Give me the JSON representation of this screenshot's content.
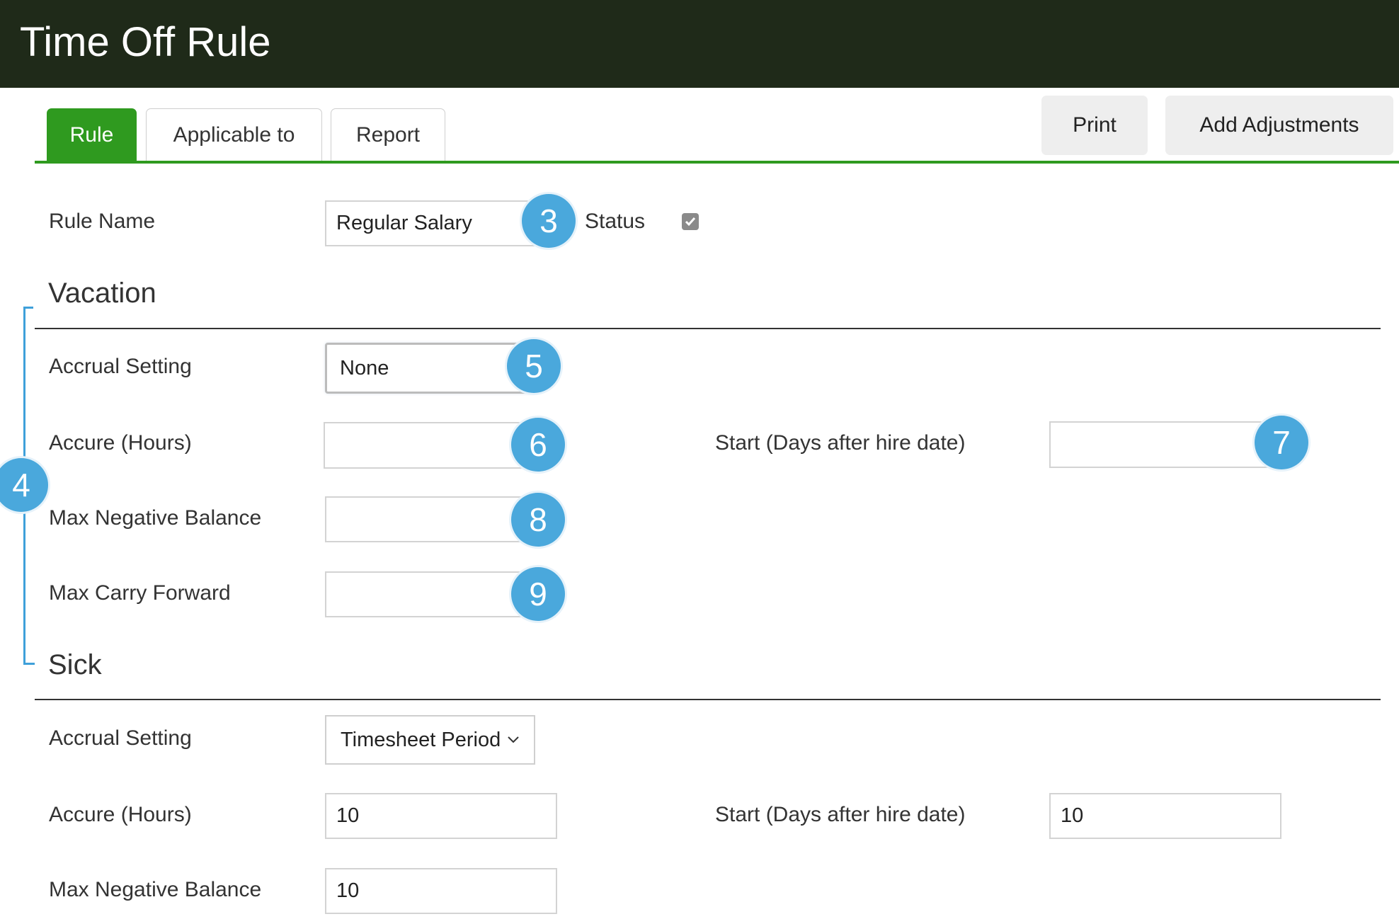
{
  "header": {
    "title": "Time Off Rule"
  },
  "tabs": [
    {
      "label": "Rule",
      "active": true
    },
    {
      "label": "Applicable to",
      "active": false
    },
    {
      "label": "Report",
      "active": false
    }
  ],
  "toolbar": {
    "print_label": "Print",
    "add_adjustments_label": "Add Adjustments"
  },
  "rule": {
    "name_label": "Rule Name",
    "name_value": "Regular Salary",
    "status_label": "Status",
    "status_checked": true
  },
  "vacation": {
    "title": "Vacation",
    "accrual_setting_label": "Accrual Setting",
    "accrual_setting_value": "None",
    "accure_label": "Accure (Hours)",
    "accure_value": "",
    "start_label": "Start (Days after hire date)",
    "start_value": "",
    "max_negative_label": "Max Negative Balance",
    "max_negative_value": "",
    "max_carry_label": "Max Carry Forward",
    "max_carry_value": ""
  },
  "sick": {
    "title": "Sick",
    "accrual_setting_label": "Accrual Setting",
    "accrual_setting_value": "Timesheet Period",
    "accure_label": "Accure (Hours)",
    "accure_value": "10",
    "start_label": "Start (Days after hire date)",
    "start_value": "10",
    "max_negative_label": "Max Negative Balance",
    "max_negative_value": "10"
  },
  "markers": {
    "m3": "3",
    "m4": "4",
    "m5": "5",
    "m6": "6",
    "m7": "7",
    "m8": "8",
    "m9": "9"
  },
  "colors": {
    "header_bg": "#1f2a19",
    "accent_green": "#2f9a1f",
    "marker_blue": "#4aa8dc"
  }
}
